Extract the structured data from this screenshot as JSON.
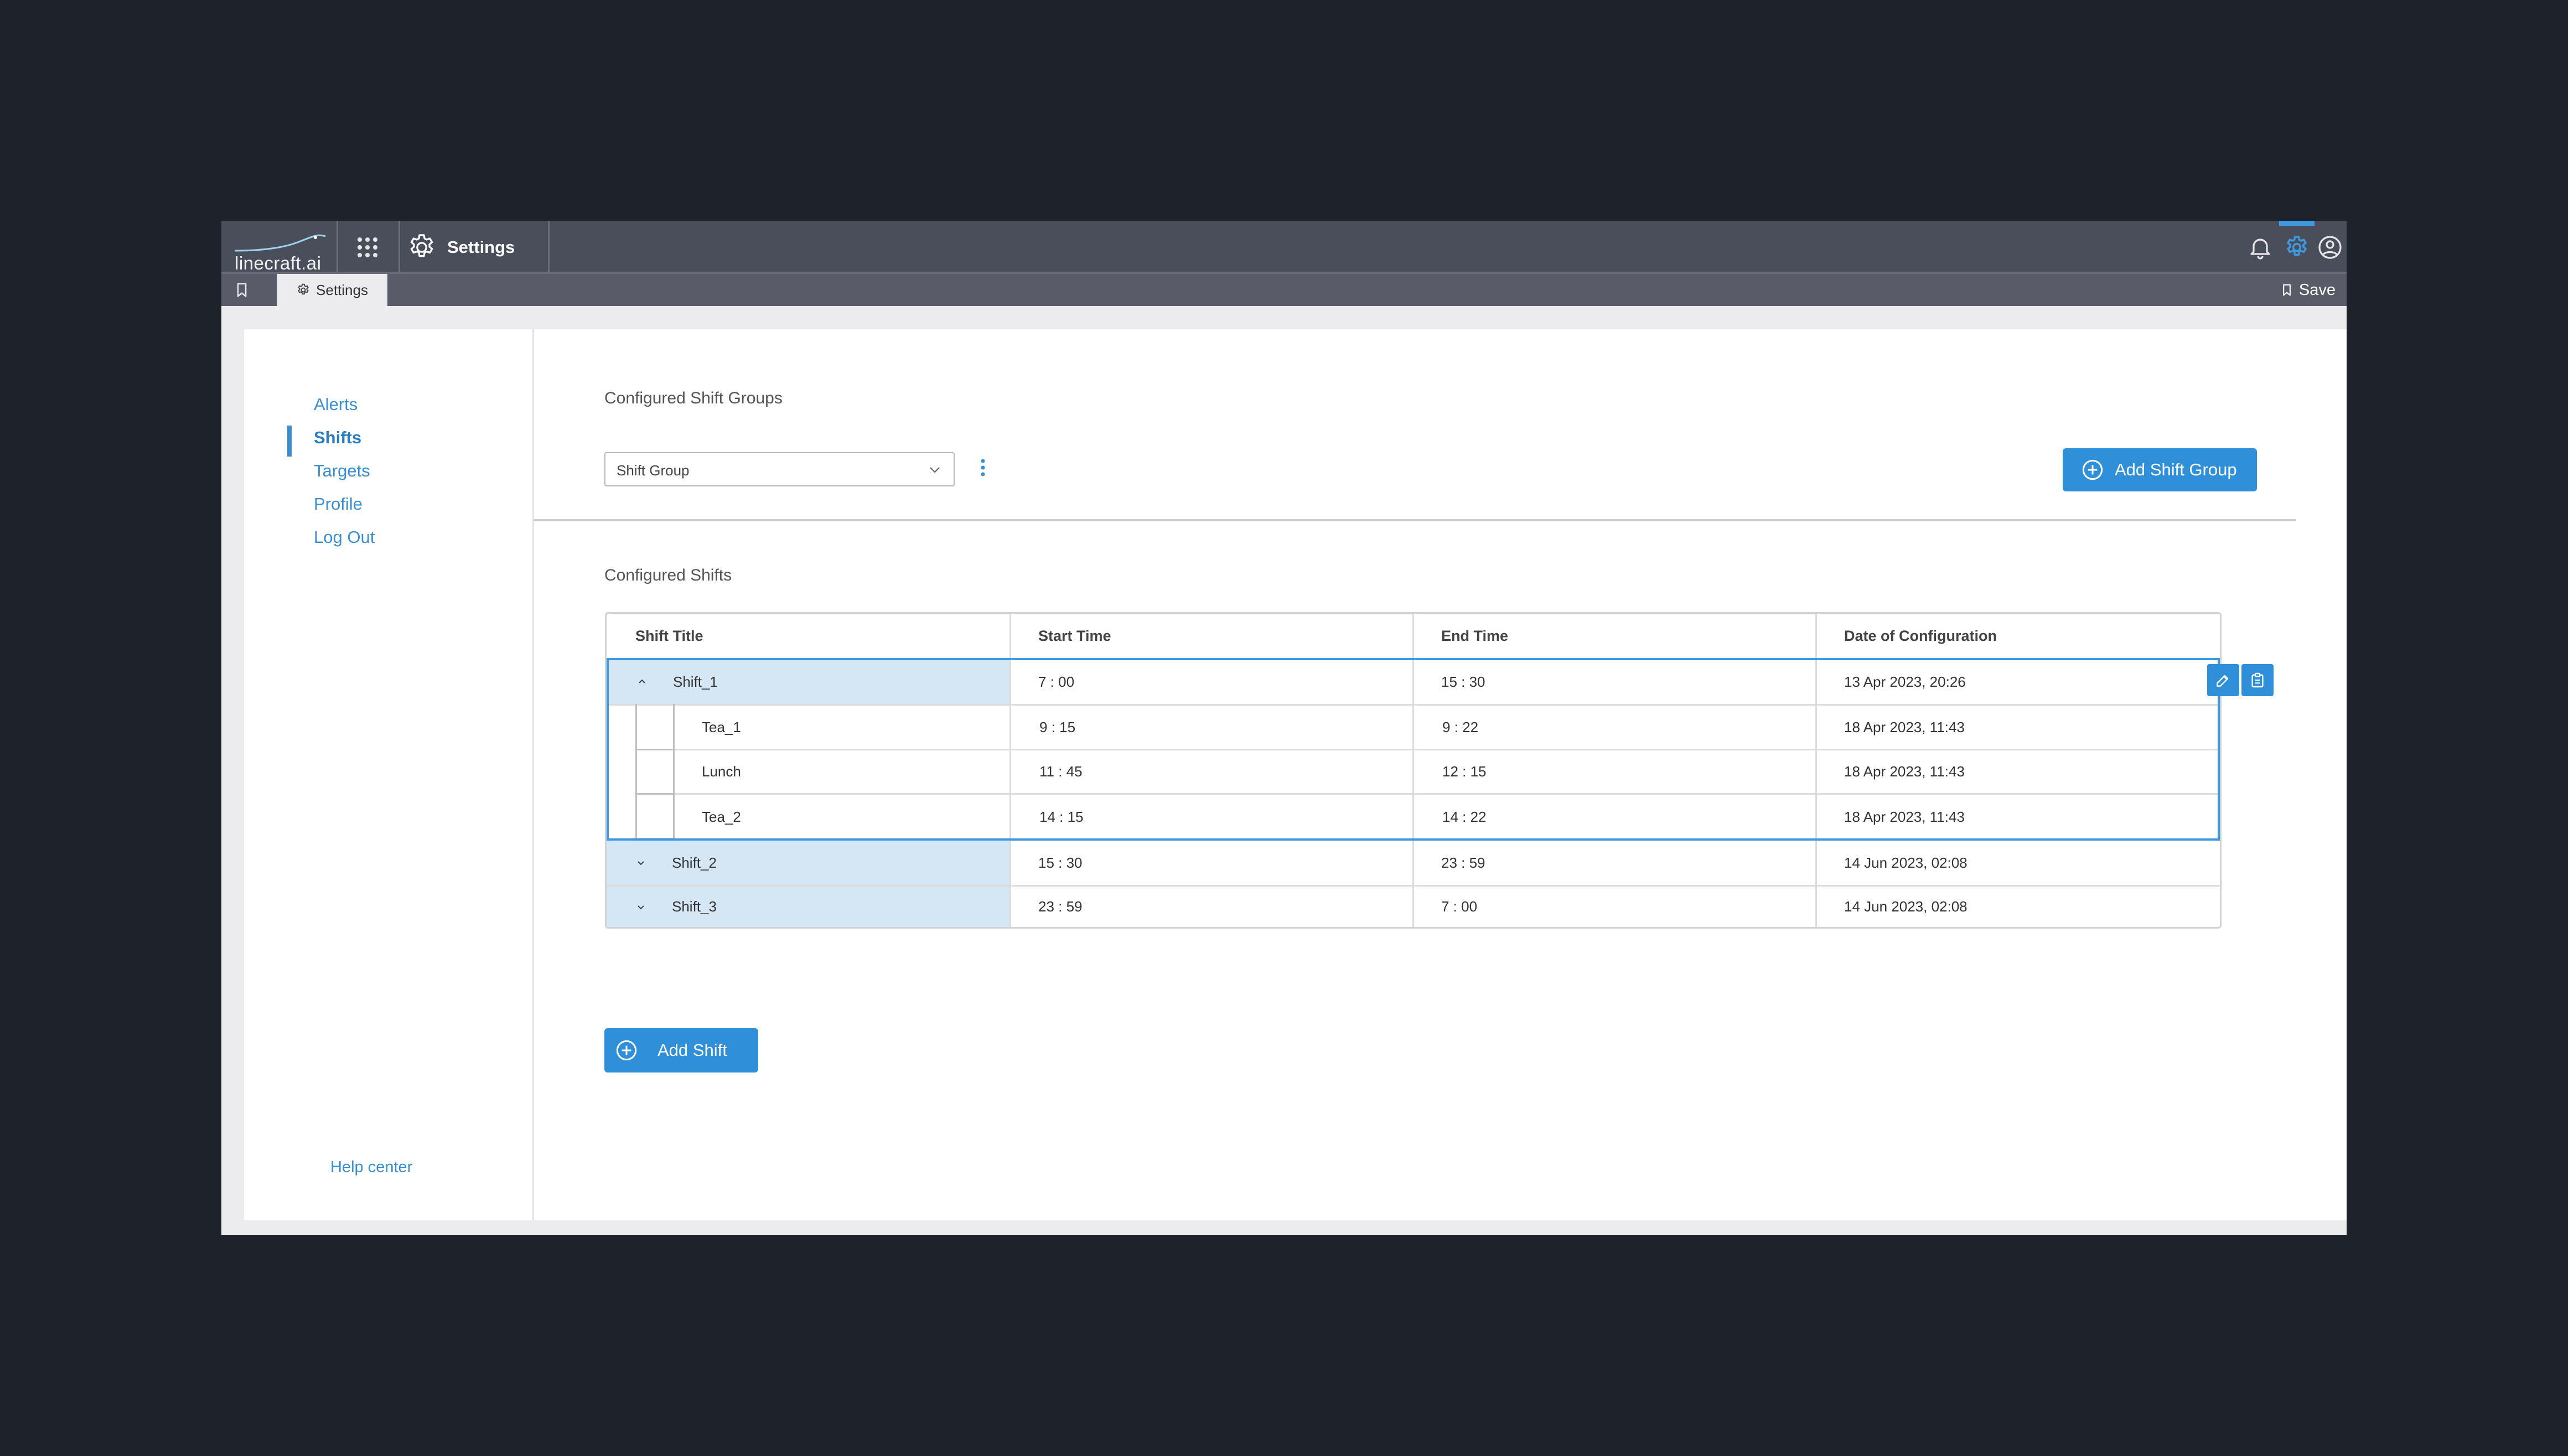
{
  "app": {
    "logo_text": "linecraft.ai",
    "module_title": "Settings"
  },
  "tabbar": {
    "tab_label": "Settings",
    "save_label": "Save"
  },
  "sidebar": {
    "items": [
      {
        "label": "Alerts"
      },
      {
        "label": "Shifts",
        "active": true
      },
      {
        "label": "Targets"
      },
      {
        "label": "Profile"
      },
      {
        "label": "Log Out"
      }
    ],
    "help_label": "Help center"
  },
  "groups": {
    "title": "Configured Shift Groups",
    "select_value": "Shift Group",
    "add_group_label": "Add Shift Group"
  },
  "shifts": {
    "title": "Configured Shifts",
    "columns": [
      "Shift Title",
      "Start Time",
      "End Time",
      "Date of Configuration"
    ],
    "rows": [
      {
        "title": "Shift_1",
        "start": "7 : 00",
        "end": "15 : 30",
        "date": "13 Apr 2023, 20:26",
        "expanded": true
      },
      {
        "title": "Tea_1",
        "start": "9 : 15",
        "end": "9 : 22",
        "date": "18 Apr 2023, 11:43",
        "child": true
      },
      {
        "title": "Lunch",
        "start": "11 : 45",
        "end": "12 : 15",
        "date": "18 Apr 2023, 11:43",
        "child": true
      },
      {
        "title": "Tea_2",
        "start": "14 : 15",
        "end": "14 : 22",
        "date": "18 Apr 2023, 11:43",
        "child": true
      },
      {
        "title": "Shift_2",
        "start": "15 : 30",
        "end": "23 : 59",
        "date": "14 Jun 2023, 02:08"
      },
      {
        "title": "Shift_3",
        "start": "23 : 59",
        "end": "7 : 00",
        "date": "14 Jun 2023, 02:08"
      }
    ],
    "add_shift_label": "Add Shift"
  },
  "colors": {
    "accent": "#2f8fd8",
    "topbar": "#4a4d5a",
    "row_highlight": "#d5e7f5",
    "background": "#1e232b"
  }
}
